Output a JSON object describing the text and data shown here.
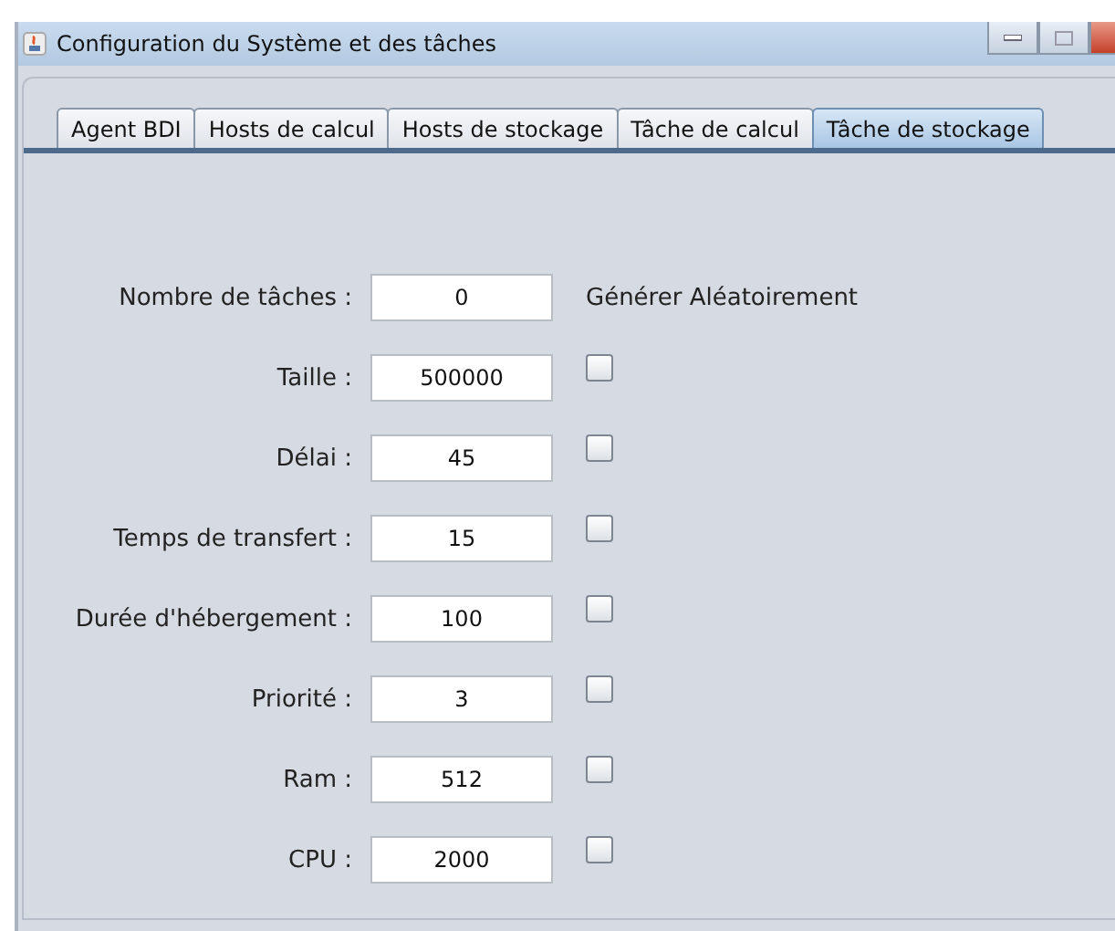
{
  "window": {
    "title": "Configuration du Système et des tâches"
  },
  "tabs": [
    {
      "label": "Agent BDI",
      "selected": false
    },
    {
      "label": "Hosts de calcul",
      "selected": false
    },
    {
      "label": "Hosts de stockage",
      "selected": false
    },
    {
      "label": "Tâche de calcul",
      "selected": false
    },
    {
      "label": "Tâche de stockage",
      "selected": true
    }
  ],
  "random_header": "Générer Aléatoirement",
  "fields": [
    {
      "kind": "count",
      "label": "Nombre de tâches :",
      "value": "0"
    },
    {
      "kind": "param",
      "label": "Taille :",
      "value": "500000",
      "checked": false
    },
    {
      "kind": "param",
      "label": "Délai :",
      "value": "45",
      "checked": false
    },
    {
      "kind": "param",
      "label": "Temps de transfert :",
      "value": "15",
      "checked": false
    },
    {
      "kind": "param",
      "label": "Durée d'hébergement :",
      "value": "100",
      "checked": false
    },
    {
      "kind": "param",
      "label": "Priorité :",
      "value": "3",
      "checked": false
    },
    {
      "kind": "param",
      "label": "Ram :",
      "value": "512",
      "checked": false
    },
    {
      "kind": "param",
      "label": "CPU :",
      "value": "2000",
      "checked": false
    }
  ]
}
